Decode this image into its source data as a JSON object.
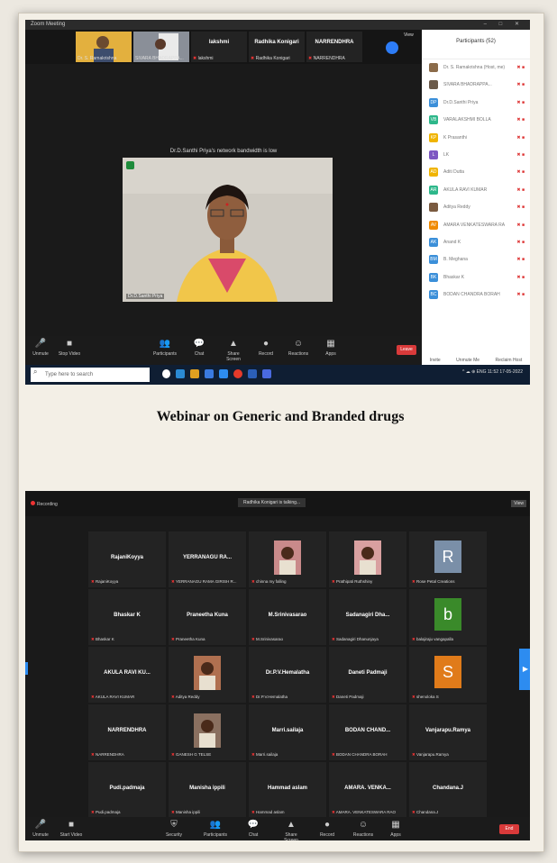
{
  "caption": "Webinar on Generic and Branded drugs",
  "zoom1": {
    "window_title": "Zoom Meeting",
    "thumbs": [
      {
        "caption": "Dr. S. Ramakrishna"
      },
      {
        "caption": "SIVARA BHADRAPPA..."
      }
    ],
    "name_tiles": [
      {
        "name": "lakshmi",
        "caption": "lakshmi"
      },
      {
        "name": "Radhika Konigari",
        "caption": "Radhika Konigari"
      },
      {
        "name": "NARRENDHRA",
        "caption": "NARRENDHRA"
      }
    ],
    "view_label": "View",
    "bandwidth_msg": "Dr.D.Santhi Priya's network bandwidth is low",
    "speaker_caption": "Dr.D.Santhi Priya",
    "participants_title": "Participants (52)",
    "participants": [
      {
        "initials": "",
        "name": "Dr. S. Ramakrishna (Host, me)",
        "color": "#8b6b4a"
      },
      {
        "initials": "",
        "name": "SIVARA BHADRAPPA...",
        "color": "#6b5a4a"
      },
      {
        "initials": "DP",
        "name": "Dr.D.Santhi Priya",
        "color": "#3b8fd9"
      },
      {
        "initials": "VB",
        "name": "VARALAKSHMI BOLLA",
        "color": "#2db78a"
      },
      {
        "initials": "KP",
        "name": "K Prasanthi",
        "color": "#f0b400"
      },
      {
        "initials": "L",
        "name": "LK",
        "color": "#7e57c2"
      },
      {
        "initials": "AD",
        "name": "Aditi Dutta",
        "color": "#f0b400"
      },
      {
        "initials": "AR",
        "name": "AKULA RAVI KUMAR",
        "color": "#2db78a"
      },
      {
        "initials": "",
        "name": "Aditya Reddy",
        "color": "#7a5a40"
      },
      {
        "initials": "AV",
        "name": "AMARA VENKATESWARA RAO",
        "color": "#f08a00"
      },
      {
        "initials": "AK",
        "name": "Anand K",
        "color": "#3b8fd9"
      },
      {
        "initials": "BM",
        "name": "B. Meghana",
        "color": "#3b8fd9"
      },
      {
        "initials": "BK",
        "name": "Bhaskar K",
        "color": "#3b8fd9"
      },
      {
        "initials": "BC",
        "name": "BODAN CHANDRA BORAH",
        "color": "#3b8fd9"
      }
    ],
    "panel_footer": [
      "Invite",
      "Unmute Me",
      "Reclaim Host"
    ],
    "toolbar": [
      {
        "icon": "🎤",
        "label": "Unmute"
      },
      {
        "icon": "■",
        "label": "Stop Video"
      },
      {
        "icon": "👥",
        "label": "Participants"
      },
      {
        "icon": "💬",
        "label": "Chat"
      },
      {
        "icon": "▲",
        "label": "Share Screen"
      },
      {
        "icon": "●",
        "label": "Record"
      },
      {
        "icon": "☺",
        "label": "Reactions"
      },
      {
        "icon": "▦",
        "label": "Apps"
      }
    ],
    "end_label": "Leave",
    "search_placeholder": "Type here to search",
    "tray_text": "^ ☁ ⊕ ENG 11:52 17-05-2022"
  },
  "zoom2": {
    "recording_label": "Recording",
    "talking_label": "Radhika Konigari is talking...",
    "view_label": "View",
    "tiles": [
      {
        "name": "RajaniKoyya",
        "caption": "RajaniKoyya",
        "kind": "name"
      },
      {
        "name": "YERRANAGU RA...",
        "caption": "YERRANAGU RAMA GIRISH R...",
        "kind": "name"
      },
      {
        "name": "",
        "caption": "chinna my falling",
        "kind": "photo",
        "color": "#c98a8a"
      },
      {
        "name": "",
        "caption": "Prathipati Ruthshiny",
        "kind": "photo",
        "color": "#d9a0a0"
      },
      {
        "name": "R",
        "caption": "Rose Petal Creations",
        "kind": "avatar",
        "color": "#7a8fa8"
      },
      {
        "name": "Bhaskar K",
        "caption": "Bhaskar K",
        "kind": "name"
      },
      {
        "name": "Praneetha Kuna",
        "caption": "Praneetha Kuna",
        "kind": "name"
      },
      {
        "name": "M.Srinivasarao",
        "caption": "M.Srinivasarao",
        "kind": "name"
      },
      {
        "name": "Sadanagiri Dha...",
        "caption": "Sadanagiri Dhanunjaya",
        "kind": "name"
      },
      {
        "name": "b",
        "caption": "balajiraju vangapalla",
        "kind": "avatar",
        "color": "#3a8a2a"
      },
      {
        "name": "AKULA RAVI KU...",
        "caption": "AKULA RAVI KUMAR",
        "kind": "name"
      },
      {
        "name": "",
        "caption": "Aditya Reddy",
        "kind": "photo",
        "color": "#b07050"
      },
      {
        "name": "Dr.P.V.Hemalatha",
        "caption": "Dr.P.V.Hemalatha",
        "kind": "name"
      },
      {
        "name": "Daneti Padmaji",
        "caption": "Daneti Padmaji",
        "kind": "name"
      },
      {
        "name": "S",
        "caption": "shenoloka S",
        "kind": "avatar",
        "color": "#e07b1a"
      },
      {
        "name": "NARRENDHRA",
        "caption": "NARRENDHRA",
        "kind": "name"
      },
      {
        "name": "",
        "caption": "GANESH G TELSE",
        "kind": "photo",
        "color": "#8a7060"
      },
      {
        "name": "Marri.sailaja",
        "caption": "Marri.sailaja",
        "kind": "name"
      },
      {
        "name": "BODAN CHAND...",
        "caption": "BODAN CHANDRA BORAH",
        "kind": "name"
      },
      {
        "name": "Vanjarapu.Ramya",
        "caption": "Vanjarapu.Ramya",
        "kind": "name"
      },
      {
        "name": "Pudi.padmaja",
        "caption": "Pudi.padmaja",
        "kind": "name"
      },
      {
        "name": "Manisha ippili",
        "caption": "Manisha ippili",
        "kind": "name"
      },
      {
        "name": "Hammad aslam",
        "caption": "Hammad aslam",
        "kind": "name"
      },
      {
        "name": "AMARA. VENKA...",
        "caption": "AMARA. VENKATESWARA RAO",
        "kind": "name"
      },
      {
        "name": "Chandana.J",
        "caption": "Chandana.J",
        "kind": "name"
      }
    ],
    "toolbar": [
      {
        "icon": "🎤",
        "label": "Unmute"
      },
      {
        "icon": "■",
        "label": "Start Video"
      },
      {
        "icon": "⛨",
        "label": "Security"
      },
      {
        "icon": "👥",
        "label": "Participants"
      },
      {
        "icon": "💬",
        "label": "Chat"
      },
      {
        "icon": "▲",
        "label": "Share Screen"
      },
      {
        "icon": "●",
        "label": "Record"
      },
      {
        "icon": "☺",
        "label": "Reactions"
      },
      {
        "icon": "▦",
        "label": "Apps"
      }
    ],
    "end_label": "End"
  }
}
